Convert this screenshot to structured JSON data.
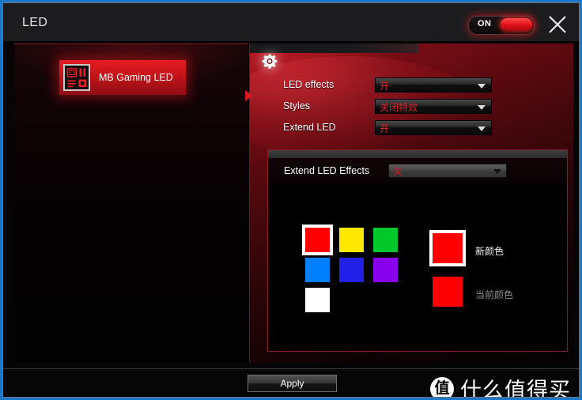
{
  "window": {
    "title": "LED",
    "accent_color": "#1b78c8",
    "power_toggle": {
      "label": "ON",
      "state": "on",
      "color": "#e01016"
    },
    "close_icon": "close-icon"
  },
  "sidebar": {
    "items": [
      {
        "label": "MB Gaming LED",
        "icon": "motherboard-icon",
        "selected": true
      }
    ]
  },
  "panel": {
    "header_icon": "gear-icon",
    "settings": [
      {
        "label": "LED effects",
        "value": "开"
      },
      {
        "label": "Styles",
        "value": "关闭特效"
      },
      {
        "label": "Extend LED",
        "value": "开"
      }
    ],
    "extend_panel": {
      "label": "Extend LED Effects",
      "value": "关",
      "palette": [
        {
          "name": "red",
          "hex": "#FF0000",
          "selected": true
        },
        {
          "name": "yellow",
          "hex": "#FFE800",
          "selected": false
        },
        {
          "name": "green",
          "hex": "#00C82A",
          "selected": false
        },
        {
          "name": "azure",
          "hex": "#0080FF",
          "selected": false
        },
        {
          "name": "blue",
          "hex": "#2020E8",
          "selected": false
        },
        {
          "name": "purple",
          "hex": "#8800EE",
          "selected": false
        },
        {
          "name": "white",
          "hex": "#FFFFFF",
          "selected": false
        }
      ],
      "new_color": {
        "label": "新颜色",
        "hex": "#FF0000",
        "label_color": "#f0f0f0"
      },
      "current_color": {
        "label": "当前颜色",
        "hex": "#FF0000",
        "label_color": "#8f8f8f"
      }
    }
  },
  "footer": {
    "apply_label": "Apply"
  },
  "watermark": {
    "badge": "值",
    "text": "什么值得买"
  }
}
